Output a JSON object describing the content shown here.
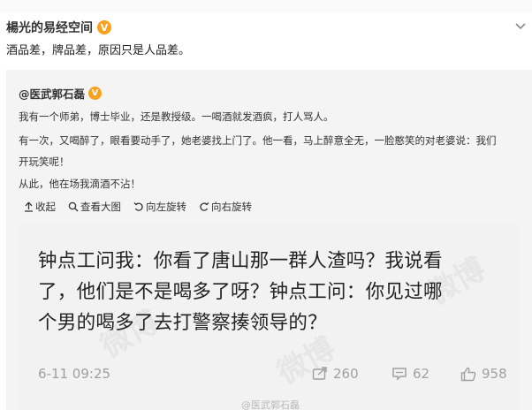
{
  "post": {
    "author": "楊光的易经空间",
    "verified_badge": "V",
    "text": "酒品差，牌品差，原因只是人品差。"
  },
  "repost": {
    "author": "@医武郭石磊",
    "verified_badge": "V",
    "lines": [
      "我有一个师弟，博士毕业，还是教授级。一喝酒就发酒疯，打人骂人。",
      "有一次，又喝醉了，眼看要动手了，她老婆找上门了。他一看，马上醉意全无，一脸憨笑的对老婆说：我们",
      "开玩笑呢！",
      "从此，他在场我滴酒不沾！"
    ],
    "toolbar": {
      "collapse": "收起",
      "view_large": "查看大图",
      "rotate_left": "向左旋转",
      "rotate_right": "向右旋转"
    },
    "image": {
      "lines": [
        "钟点工问我：你看了唐山那一群人渣吗？我说看",
        "了，他们是不是喝多了呀？钟点工问：你见过哪",
        "个男的喝多了去打警察揍领导的？"
      ],
      "timestamp": "6-11 09:25",
      "reposts": "260",
      "comments": "62",
      "likes": "958",
      "watermark": "微博",
      "watermark_user": "@医武郭石磊"
    }
  },
  "colors": {
    "badge": "#f7a11c",
    "repost_bg": "#f4f4f4",
    "image_bg": "#f2f2f2",
    "meta_gray": "#a0a0a0"
  }
}
